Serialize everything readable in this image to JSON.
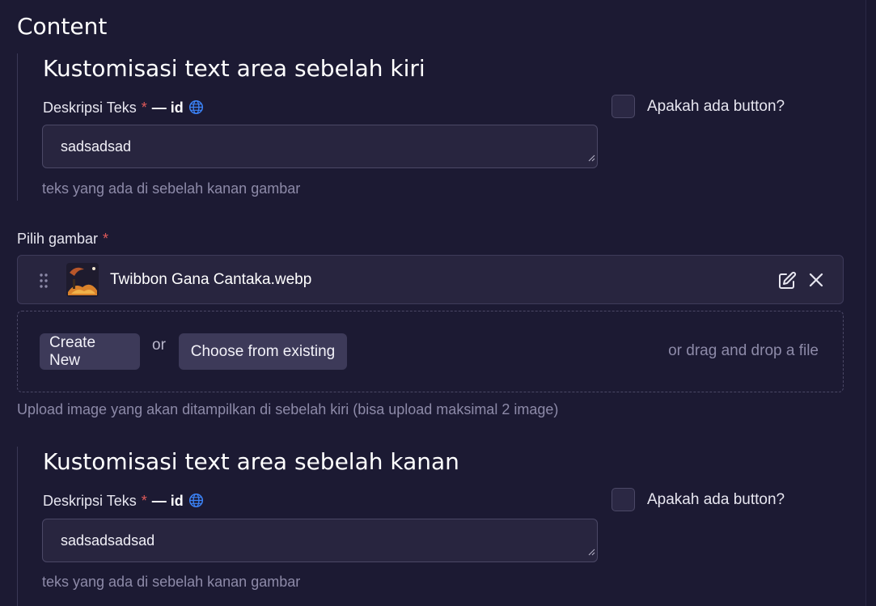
{
  "page": {
    "title": "Content"
  },
  "left_section": {
    "title": "Kustomisasi text area sebelah kiri",
    "field_label": "Deskripsi Teks",
    "required_mark": "*",
    "locale_label": "— id",
    "value": "sadsadsad",
    "helper": "teks yang ada di sebelah kanan gambar",
    "checkbox_label": "Apakah ada button?",
    "checkbox_checked": false
  },
  "image_field": {
    "label": "Pilih gambar",
    "required_mark": "*",
    "file_name": "Twibbon Gana Cantaka.webp",
    "create_label": "Create New",
    "or_label": "or",
    "choose_label": "Choose from existing",
    "drag_label": "or drag and drop a file",
    "helper": "Upload image yang akan ditampilkan di sebelah kiri (bisa upload maksimal 2 image)"
  },
  "right_section": {
    "title": "Kustomisasi text area sebelah kanan",
    "field_label": "Deskripsi Teks",
    "required_mark": "*",
    "locale_label": "— id",
    "value": "sadsadsadsad",
    "helper": "teks yang ada di sebelah kanan gambar",
    "checkbox_label": "Apakah ada button?",
    "checkbox_checked": false
  },
  "icons": {
    "locale": "globe-icon",
    "drag": "drag-handle-icon",
    "edit": "edit-icon",
    "remove": "close-icon",
    "resize": "resize-grip-icon"
  },
  "colors": {
    "background": "#1c1a33",
    "field_background": "#28253f",
    "button_background": "#3d3a59",
    "required": "#e05a5a",
    "globe": "#3b82f6",
    "muted_text": "#8d8aa8"
  }
}
